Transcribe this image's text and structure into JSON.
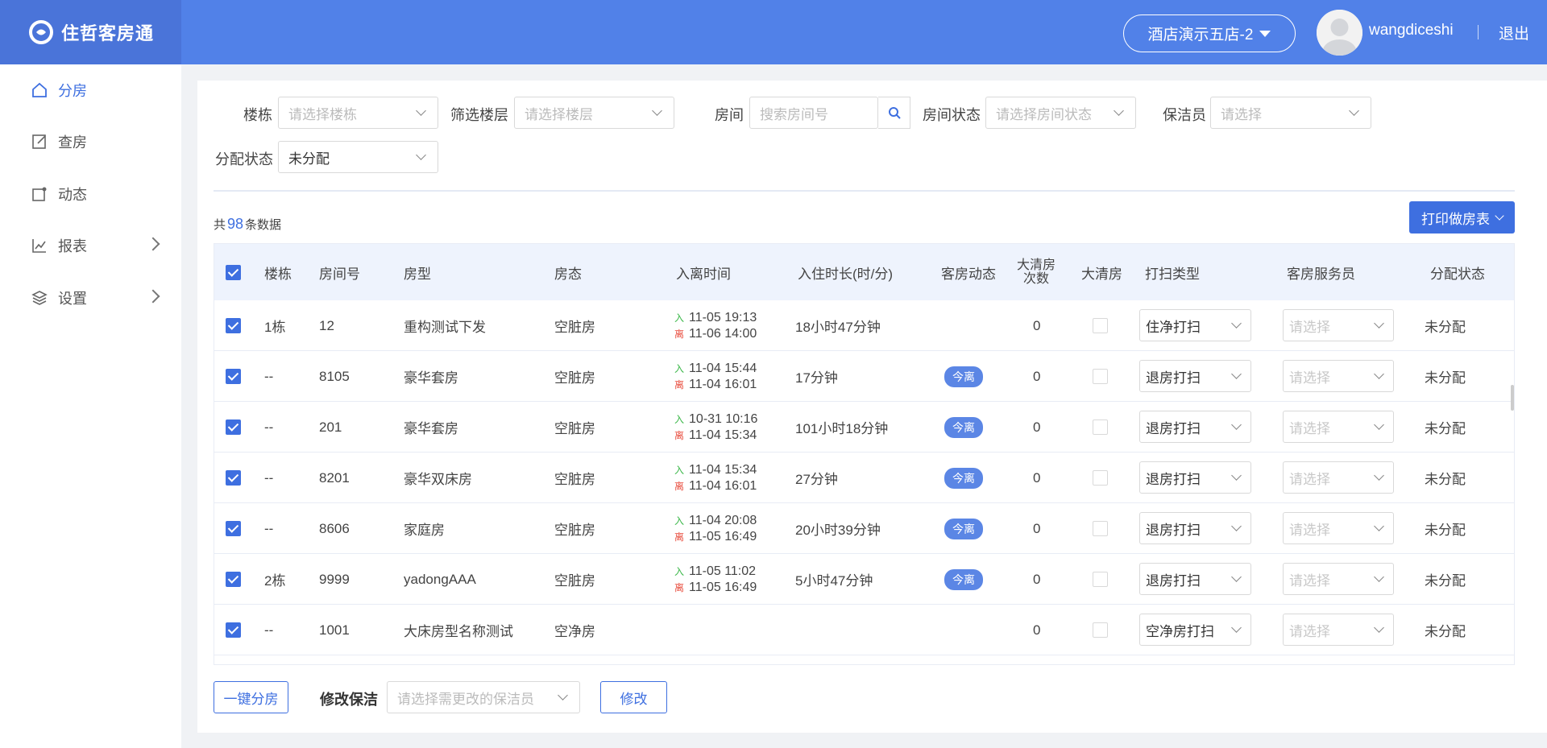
{
  "app": {
    "title": "住哲客房通"
  },
  "header": {
    "hotel": "酒店演示五店-2",
    "username": "wangdiceshi",
    "logout": "退出"
  },
  "sidebar": {
    "items": [
      {
        "label": "分房",
        "icon": "home-icon",
        "active": true
      },
      {
        "label": "查房",
        "icon": "edit-icon"
      },
      {
        "label": "动态",
        "icon": "dynamic-icon"
      },
      {
        "label": "报表",
        "icon": "chart-icon",
        "expandable": true
      },
      {
        "label": "设置",
        "icon": "layers-icon",
        "expandable": true
      }
    ]
  },
  "filters": {
    "building": {
      "label": "楼栋",
      "placeholder": "请选择楼栋"
    },
    "floor": {
      "label": "筛选楼层",
      "placeholder": "请选择楼层"
    },
    "room": {
      "label": "房间",
      "placeholder": "搜索房间号"
    },
    "room_status": {
      "label": "房间状态",
      "placeholder": "请选择房间状态"
    },
    "cleaner": {
      "label": "保洁员",
      "placeholder": "请选择"
    },
    "assign_status": {
      "label": "分配状态",
      "value": "未分配"
    }
  },
  "summary": {
    "prefix": "共",
    "count": "98",
    "suffix": "条数据"
  },
  "print_button": "打印做房表",
  "table": {
    "headers": {
      "building": "楼栋",
      "room_no": "房间号",
      "room_type": "房型",
      "status": "房态",
      "time": "入离时间",
      "duration": "入住时长(时/分)",
      "dynamic": "客房动态",
      "deep_count_1": "大清房",
      "deep_count_2": "次数",
      "deep": "大清房",
      "clean_type": "打扫类型",
      "attendant": "客房服务员",
      "assign": "分配状态"
    },
    "in_label": "入",
    "out_label": "离",
    "attendant_placeholder": "请选择",
    "rows": [
      {
        "building": "1栋",
        "room": "12",
        "type": "重构测试下发",
        "status": "空脏房",
        "in": "11-05 19:13",
        "out": "11-06 14:00",
        "duration": "18小时47分钟",
        "dynamic": "",
        "count": "0",
        "clean": "住净打扫",
        "assign": "未分配"
      },
      {
        "building": "--",
        "room": "8105",
        "type": "豪华套房",
        "status": "空脏房",
        "in": "11-04 15:44",
        "out": "11-04 16:01",
        "duration": "17分钟",
        "dynamic": "今离",
        "count": "0",
        "clean": "退房打扫",
        "assign": "未分配"
      },
      {
        "building": "--",
        "room": "201",
        "type": "豪华套房",
        "status": "空脏房",
        "in": "10-31 10:16",
        "out": "11-04 15:34",
        "duration": "101小时18分钟",
        "dynamic": "今离",
        "count": "0",
        "clean": "退房打扫",
        "assign": "未分配"
      },
      {
        "building": "--",
        "room": "8201",
        "type": "豪华双床房",
        "status": "空脏房",
        "in": "11-04 15:34",
        "out": "11-04 16:01",
        "duration": "27分钟",
        "dynamic": "今离",
        "count": "0",
        "clean": "退房打扫",
        "assign": "未分配"
      },
      {
        "building": "--",
        "room": "8606",
        "type": "家庭房",
        "status": "空脏房",
        "in": "11-04 20:08",
        "out": "11-05 16:49",
        "duration": "20小时39分钟",
        "dynamic": "今离",
        "count": "0",
        "clean": "退房打扫",
        "assign": "未分配"
      },
      {
        "building": "2栋",
        "room": "9999",
        "type": "yadongAAA",
        "status": "空脏房",
        "in": "11-05 11:02",
        "out": "11-05 16:49",
        "duration": "5小时47分钟",
        "dynamic": "今离",
        "count": "0",
        "clean": "退房打扫",
        "assign": "未分配"
      },
      {
        "building": "--",
        "room": "1001",
        "type": "大床房型名称测试",
        "status": "空净房",
        "in": "",
        "out": "",
        "duration": "",
        "dynamic": "",
        "count": "0",
        "clean": "空净房打扫",
        "assign": "未分配"
      }
    ]
  },
  "footer": {
    "assign_all": "一键分房",
    "modify_label": "修改保洁",
    "modify_placeholder": "请选择需更改的保洁员",
    "modify_button": "修改"
  },
  "colors": {
    "header": "#5181e8",
    "logo_bg": "#4a74d9",
    "accent": "#3e6fe0",
    "in": "#3cb84a",
    "out": "#e84c3d"
  }
}
